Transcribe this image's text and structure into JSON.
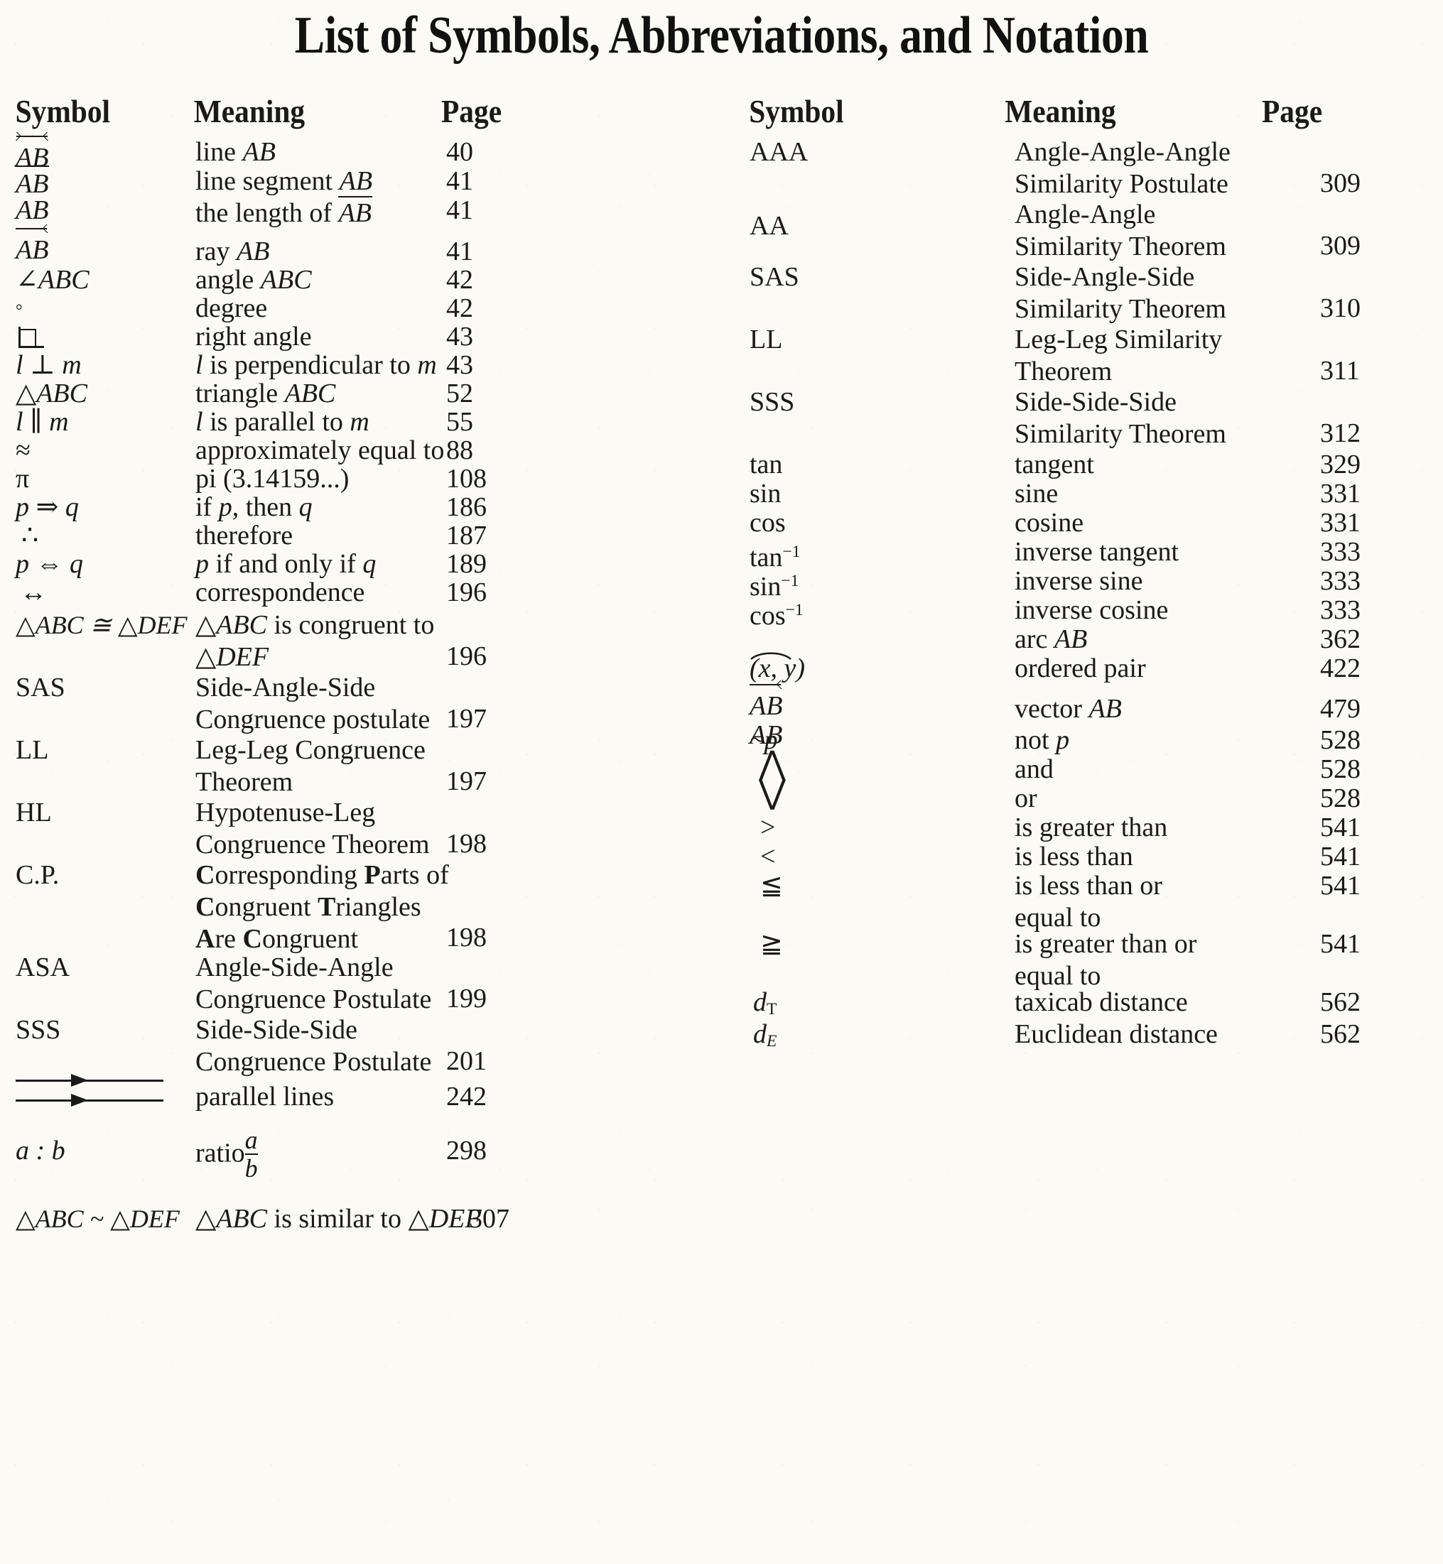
{
  "page": {
    "title": "List of Symbols, Abbreviations, and Notation",
    "background_color": "#fbfaf4",
    "text_color": "#1a1a18"
  },
  "columns": {
    "left": {
      "headers": {
        "symbol": "Symbol",
        "meaning": "Meaning",
        "page": "Page"
      },
      "rows": [
        {
          "symbol_glyph": "line-AB-overleftrightarrow",
          "symbol_text": "AB",
          "meaning": "line AB",
          "page": "40"
        },
        {
          "symbol_glyph": "segment-AB-overline",
          "symbol_text": "AB",
          "meaning": "line segment AB",
          "page": "41"
        },
        {
          "symbol_glyph": "plain-AB",
          "symbol_text": "AB",
          "meaning": "the length of AB",
          "page": "41"
        },
        {
          "symbol_glyph": "ray-AB-overrightarrow",
          "symbol_text": "AB",
          "meaning": "ray AB",
          "page": "41"
        },
        {
          "symbol_glyph": "angle-ABC",
          "symbol_text": "∠ABC",
          "meaning": "angle ABC",
          "page": "42"
        },
        {
          "symbol_glyph": "degree-sign",
          "symbol_text": "°",
          "meaning": "degree",
          "page": "42"
        },
        {
          "symbol_glyph": "right-angle-box",
          "symbol_text": "",
          "meaning": "right angle",
          "page": "43"
        },
        {
          "symbol_glyph": "perpendicular",
          "symbol_text": "l ⊥ m",
          "meaning": "l is perpendicular to m",
          "page": "43"
        },
        {
          "symbol_glyph": "triangle-ABC",
          "symbol_text": "△ABC",
          "meaning": "triangle ABC",
          "page": "52"
        },
        {
          "symbol_glyph": "parallel",
          "symbol_text": "l ∥ m",
          "meaning": "l is parallel to m",
          "page": "55"
        },
        {
          "symbol_glyph": "approximately-equal",
          "symbol_text": "≈",
          "meaning": "approximately equal to",
          "page": "88"
        },
        {
          "symbol_glyph": "pi",
          "symbol_text": "π",
          "meaning": "pi (3.14159...)",
          "page": "108"
        },
        {
          "symbol_glyph": "implies",
          "symbol_text": "p ⇒ q",
          "meaning": "if p, then q",
          "page": "186"
        },
        {
          "symbol_glyph": "therefore",
          "symbol_text": "∴",
          "meaning": "therefore",
          "page": "187"
        },
        {
          "symbol_glyph": "if-and-only-if",
          "symbol_text": "p ⇔ q",
          "meaning": "p if and only if q",
          "page": "189"
        },
        {
          "symbol_glyph": "correspondence",
          "symbol_text": "↔",
          "meaning": "correspondence",
          "page": "196"
        },
        {
          "symbol_glyph": "triangle-congruence",
          "symbol_text": "△ABC ≅ △DEF",
          "meaning": "△ABC is congruent to\n△DEF",
          "page": "196"
        },
        {
          "symbol_glyph": "SAS",
          "symbol_text": "SAS",
          "meaning": "Side-Angle-Side\nCongruence postulate",
          "page": "197"
        },
        {
          "symbol_glyph": "LL",
          "symbol_text": "LL",
          "meaning": "Leg-Leg Congruence\nTheorem",
          "page": "197"
        },
        {
          "symbol_glyph": "HL",
          "symbol_text": "HL",
          "meaning": "Hypotenuse-Leg\nCongruence Theorem",
          "page": "198"
        },
        {
          "symbol_glyph": "CP",
          "symbol_text": "C.P.",
          "meaning": "Corresponding Parts of\nCongruent Triangles\nAre Congruent",
          "page": "198"
        },
        {
          "symbol_glyph": "ASA",
          "symbol_text": "ASA",
          "meaning": "Angle-Side-Angle\nCongruence Postulate",
          "page": "199"
        },
        {
          "symbol_glyph": "SSS",
          "symbol_text": "SSS",
          "meaning": "Side-Side-Side\nCongruence Postulate",
          "page": "201"
        },
        {
          "symbol_glyph": "parallel-lines-arrows",
          "symbol_text": "",
          "meaning": "parallel lines",
          "page": "242"
        },
        {
          "symbol_glyph": "ratio",
          "symbol_text": "a : b",
          "meaning": "ratio",
          "meaning_fraction": {
            "numerator": "a",
            "denominator": "b"
          },
          "page": "298"
        },
        {
          "symbol_glyph": "triangle-similarity",
          "symbol_text": "△ABC ~ △DEF",
          "meaning": "△ABC is similar to △DEF",
          "page": "307"
        }
      ]
    },
    "right": {
      "headers": {
        "symbol": "Symbol",
        "meaning": "Meaning",
        "page": "Page"
      },
      "rows": [
        {
          "symbol_glyph": "AAA",
          "symbol_text": "AAA",
          "meaning": "Angle-Angle-Angle\nSimilarity Postulate",
          "page": "309"
        },
        {
          "symbol_glyph": "AA",
          "symbol_text": "AA",
          "meaning": "Angle-Angle\nSimilarity Theorem",
          "page": "309"
        },
        {
          "symbol_glyph": "SAS",
          "symbol_text": "SAS",
          "meaning": "Side-Angle-Side\nSimilarity Theorem",
          "page": "310"
        },
        {
          "symbol_glyph": "LL",
          "symbol_text": "LL",
          "meaning": "Leg-Leg Similarity\nTheorem",
          "page": "311"
        },
        {
          "symbol_glyph": "SSS",
          "symbol_text": "SSS",
          "meaning": "Side-Side-Side\nSimilarity Theorem",
          "page": "312"
        },
        {
          "symbol_glyph": "tan",
          "symbol_text": "tan",
          "meaning": "tangent",
          "page": "329"
        },
        {
          "symbol_glyph": "sin",
          "symbol_text": "sin",
          "meaning": "sine",
          "page": "331"
        },
        {
          "symbol_glyph": "cos",
          "symbol_text": "cos",
          "meaning": "cosine",
          "page": "331"
        },
        {
          "symbol_glyph": "arctan",
          "symbol_text": "tan⁻¹",
          "meaning": "inverse tangent",
          "page": "333"
        },
        {
          "symbol_glyph": "arcsin",
          "symbol_text": "sin⁻¹",
          "meaning": "inverse sine",
          "page": "333"
        },
        {
          "symbol_glyph": "arccos",
          "symbol_text": "cos⁻¹",
          "meaning": "inverse cosine",
          "page": "333"
        },
        {
          "symbol_glyph": "arc-AB-overarc",
          "symbol_text": "AB",
          "meaning": "arc AB",
          "page": "362"
        },
        {
          "symbol_glyph": "ordered-pair",
          "symbol_text": "(x, y)",
          "meaning": "ordered pair",
          "page": "422"
        },
        {
          "symbol_glyph": "vector-AB-overrightarrow",
          "symbol_text": "AB",
          "meaning": "vector AB",
          "page": "479"
        },
        {
          "symbol_glyph": "negation",
          "symbol_text": "~p",
          "meaning": "not p",
          "page": "528"
        },
        {
          "symbol_glyph": "logical-and",
          "symbol_text": "⋀",
          "meaning": "and",
          "page": "528"
        },
        {
          "symbol_glyph": "logical-or",
          "symbol_text": "⋁",
          "meaning": "or",
          "page": "528"
        },
        {
          "symbol_glyph": "greater-than",
          "symbol_text": ">",
          "meaning": "is greater than",
          "page": "541"
        },
        {
          "symbol_glyph": "less-than",
          "symbol_text": "<",
          "meaning": "is less than",
          "page": "541"
        },
        {
          "symbol_glyph": "less-than-or-equal",
          "symbol_text": "≦",
          "meaning": "is less than or\nequal to",
          "page": "541"
        },
        {
          "symbol_glyph": "greater-than-or-equal",
          "symbol_text": "≧",
          "meaning": "is greater than or\nequal to",
          "page": "541"
        },
        {
          "symbol_glyph": "taxicab-distance",
          "symbol_text": "dT",
          "meaning": "taxicab distance",
          "page": "562"
        },
        {
          "symbol_glyph": "euclidean-distance",
          "symbol_text": "dE",
          "meaning": "Euclidean distance",
          "page": "562"
        }
      ]
    }
  }
}
